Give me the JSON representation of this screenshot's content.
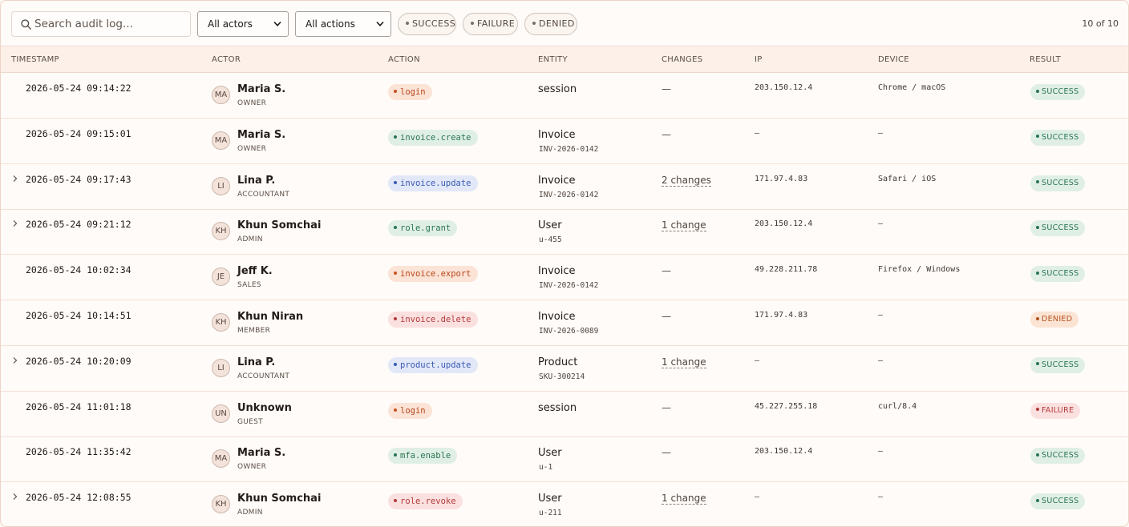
{
  "toolbar": {
    "search_placeholder": "Search audit log...",
    "actor_filter": "All actors",
    "action_filter": "All actions",
    "result_pills": [
      "SUCCESS",
      "FAILURE",
      "DENIED"
    ],
    "count": "10 of 10"
  },
  "columns": [
    "TIMESTAMP",
    "ACTOR",
    "ACTION",
    "ENTITY",
    "CHANGES",
    "IP",
    "DEVICE",
    "RESULT"
  ],
  "rows": [
    {
      "expandable": false,
      "timestamp": "2026-05-24 09:14:22",
      "initials": "MA",
      "actor": "Maria S.",
      "role": "OWNER",
      "action": "login",
      "action_color": "orange",
      "entity": "session",
      "entity_id": "",
      "changes": "—",
      "changes_link": false,
      "ip": "203.150.12.4",
      "device": "Chrome / macOS",
      "result": "SUCCESS"
    },
    {
      "expandable": false,
      "timestamp": "2026-05-24 09:15:01",
      "initials": "MA",
      "actor": "Maria S.",
      "role": "OWNER",
      "action": "invoice.create",
      "action_color": "green",
      "entity": "Invoice",
      "entity_id": "INV-2026-0142",
      "changes": "—",
      "changes_link": false,
      "ip": "–",
      "device": "–",
      "result": "SUCCESS"
    },
    {
      "expandable": true,
      "timestamp": "2026-05-24 09:17:43",
      "initials": "LI",
      "actor": "Lina P.",
      "role": "ACCOUNTANT",
      "action": "invoice.update",
      "action_color": "blue",
      "entity": "Invoice",
      "entity_id": "INV-2026-0142",
      "changes": "2 changes",
      "changes_link": true,
      "ip": "171.97.4.83",
      "device": "Safari / iOS",
      "result": "SUCCESS"
    },
    {
      "expandable": true,
      "timestamp": "2026-05-24 09:21:12",
      "initials": "KH",
      "actor": "Khun Somchai",
      "role": "ADMIN",
      "action": "role.grant",
      "action_color": "green",
      "entity": "User",
      "entity_id": "u-455",
      "changes": "1 change",
      "changes_link": true,
      "ip": "203.150.12.4",
      "device": "–",
      "result": "SUCCESS"
    },
    {
      "expandable": false,
      "timestamp": "2026-05-24 10:02:34",
      "initials": "JE",
      "actor": "Jeff K.",
      "role": "SALES",
      "action": "invoice.export",
      "action_color": "orange",
      "entity": "Invoice",
      "entity_id": "INV-2026-0142",
      "changes": "—",
      "changes_link": false,
      "ip": "49.228.211.78",
      "device": "Firefox / Windows",
      "result": "SUCCESS"
    },
    {
      "expandable": false,
      "timestamp": "2026-05-24 10:14:51",
      "initials": "KH",
      "actor": "Khun Niran",
      "role": "MEMBER",
      "action": "invoice.delete",
      "action_color": "red",
      "entity": "Invoice",
      "entity_id": "INV-2026-0089",
      "changes": "—",
      "changes_link": false,
      "ip": "171.97.4.83",
      "device": "–",
      "result": "DENIED"
    },
    {
      "expandable": true,
      "timestamp": "2026-05-24 10:20:09",
      "initials": "LI",
      "actor": "Lina P.",
      "role": "ACCOUNTANT",
      "action": "product.update",
      "action_color": "blue",
      "entity": "Product",
      "entity_id": "SKU-300214",
      "changes": "1 change",
      "changes_link": true,
      "ip": "–",
      "device": "–",
      "result": "SUCCESS"
    },
    {
      "expandable": false,
      "timestamp": "2026-05-24 11:01:18",
      "initials": "UN",
      "actor": "Unknown",
      "role": "GUEST",
      "action": "login",
      "action_color": "orange",
      "entity": "session",
      "entity_id": "",
      "changes": "—",
      "changes_link": false,
      "ip": "45.227.255.18",
      "device": "curl/8.4",
      "result": "FAILURE"
    },
    {
      "expandable": false,
      "timestamp": "2026-05-24 11:35:42",
      "initials": "MA",
      "actor": "Maria S.",
      "role": "OWNER",
      "action": "mfa.enable",
      "action_color": "green",
      "entity": "User",
      "entity_id": "u-1",
      "changes": "—",
      "changes_link": false,
      "ip": "203.150.12.4",
      "device": "–",
      "result": "SUCCESS"
    },
    {
      "expandable": true,
      "timestamp": "2026-05-24 12:08:55",
      "initials": "KH",
      "actor": "Khun Somchai",
      "role": "ADMIN",
      "action": "role.revoke",
      "action_color": "red",
      "entity": "User",
      "entity_id": "u-211",
      "changes": "1 change",
      "changes_link": true,
      "ip": "–",
      "device": "–",
      "result": "SUCCESS"
    }
  ]
}
